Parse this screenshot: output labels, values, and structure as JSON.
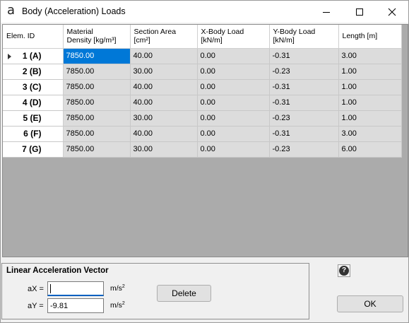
{
  "window": {
    "app_icon_glyph": "a",
    "title": "Body (Acceleration) Loads"
  },
  "grid": {
    "columns": [
      {
        "line1": "Elem. ID",
        "line2": ""
      },
      {
        "line1": "Material",
        "line2": "Density [kg/m³]"
      },
      {
        "line1": "Section Area",
        "line2": "[cm²]"
      },
      {
        "line1": "X-Body Load",
        "line2": "[kN/m]"
      },
      {
        "line1": "Y-Body Load",
        "line2": "[kN/m]"
      },
      {
        "line1": "Length [m]",
        "line2": ""
      }
    ],
    "rows": [
      {
        "id": "1 (A)",
        "density": "7850.00",
        "area": "40.00",
        "xload": "0.00",
        "yload": "-0.31",
        "length": "3.00"
      },
      {
        "id": "2 (B)",
        "density": "7850.00",
        "area": "30.00",
        "xload": "0.00",
        "yload": "-0.23",
        "length": "1.00"
      },
      {
        "id": "3 (C)",
        "density": "7850.00",
        "area": "40.00",
        "xload": "0.00",
        "yload": "-0.31",
        "length": "1.00"
      },
      {
        "id": "4 (D)",
        "density": "7850.00",
        "area": "40.00",
        "xload": "0.00",
        "yload": "-0.31",
        "length": "1.00"
      },
      {
        "id": "5 (E)",
        "density": "7850.00",
        "area": "30.00",
        "xload": "0.00",
        "yload": "-0.23",
        "length": "1.00"
      },
      {
        "id": "6 (F)",
        "density": "7850.00",
        "area": "40.00",
        "xload": "0.00",
        "yload": "-0.31",
        "length": "3.00"
      },
      {
        "id": "7 (G)",
        "density": "7850.00",
        "area": "30.00",
        "xload": "0.00",
        "yload": "-0.23",
        "length": "6.00"
      }
    ]
  },
  "acceleration": {
    "title": "Linear Acceleration Vector",
    "ax_label": "aX =",
    "ax_value": "",
    "ay_label": "aY =",
    "ay_value": "-9.81",
    "unit": "m/s",
    "unit_exp": "2",
    "delete_label": "Delete"
  },
  "help_glyph": "?",
  "ok_label": "OK",
  "colors": {
    "selection": "#0078d7",
    "grid_background": "#ababab"
  }
}
